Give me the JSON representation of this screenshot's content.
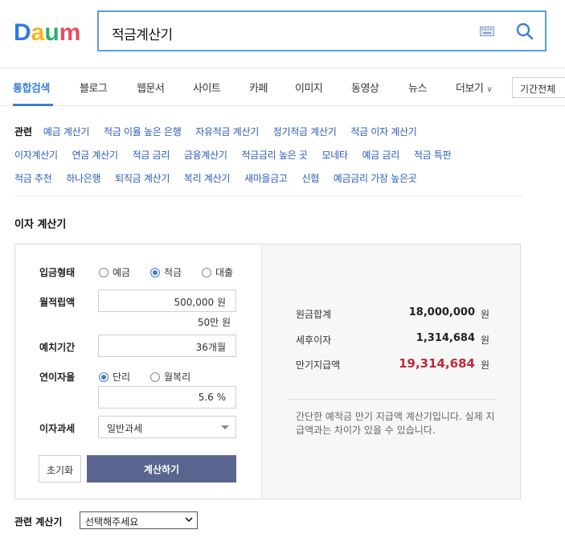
{
  "header": {
    "logo": "Daum",
    "search_query": "적금계산기",
    "icons": [
      "keyboard-icon",
      "search-icon"
    ]
  },
  "tabs": {
    "items": [
      "통합검색",
      "블로그",
      "웹문서",
      "사이트",
      "카페",
      "이미지",
      "동영상",
      "뉴스",
      "더보기"
    ],
    "active_index": 0,
    "period": "기간전체"
  },
  "related": {
    "title": "관련",
    "rows": [
      [
        "예금 계산기",
        "적금 이율 높은 은행",
        "자유적금 계산기",
        "정기적금 계산기",
        "적금 이자 계산기"
      ],
      [
        "이자계산기",
        "연금 계산기",
        "적금 금리",
        "금융계산기",
        "적금금리 높은 곳",
        "모네타",
        "예금 금리",
        "적금 특판"
      ],
      [
        "적금 추천",
        "하나은행",
        "퇴직금 계산기",
        "복리 계산기",
        "새마을금고",
        "신협",
        "예금금리 가장 높은곳"
      ]
    ]
  },
  "calculator": {
    "section_title": "이자 계산기",
    "deposit_type": {
      "label": "입금형태",
      "options": [
        "예금",
        "적금",
        "대출"
      ],
      "selected": "적금"
    },
    "monthly_deposit": {
      "label": "월적립액",
      "value": "500,000 원",
      "note": "50만 원"
    },
    "period": {
      "label": "예치기간",
      "value": "36개월"
    },
    "annual_rate": {
      "label": "연이자율",
      "options": [
        "단리",
        "월복리"
      ],
      "selected": "단리",
      "value": "5.6 %"
    },
    "tax": {
      "label": "이자과세",
      "value": "일반과세"
    },
    "reset_label": "초기화",
    "calc_label": "계산하기",
    "results": {
      "principal_label": "원금합계",
      "principal_value": "18,000,000",
      "after_tax_label": "세후이자",
      "after_tax_value": "1,314,684",
      "maturity_label": "만기지급액",
      "maturity_value": "19,314,684",
      "unit": "원",
      "note": "간단한 예적금 만기 지급액 계산기입니다. 실제 지급액과는 차이가 있을 수 있습니다."
    }
  },
  "related_calc": {
    "label": "관련 계산기",
    "placeholder": "선택해주세요"
  },
  "colors": {
    "accent": "#3b7fd6",
    "link": "#2a5bb8",
    "calc_button": "#5a6690",
    "maturity": "#c02a3a"
  }
}
